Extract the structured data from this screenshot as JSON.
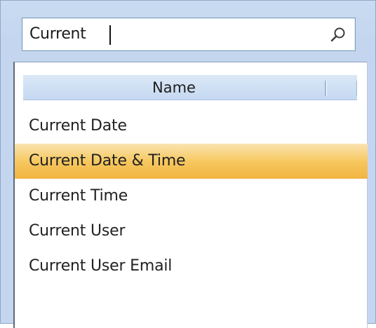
{
  "search": {
    "value": "Current",
    "icon": "search-icon"
  },
  "list": {
    "column_header": "Name",
    "items": [
      {
        "label": "Current Date",
        "selected": false
      },
      {
        "label": "Current Date & Time",
        "selected": true
      },
      {
        "label": "Current Time",
        "selected": false
      },
      {
        "label": "Current User",
        "selected": false
      },
      {
        "label": "Current User Email",
        "selected": false
      }
    ]
  },
  "colors": {
    "selection": "#f4bd4f",
    "frame": "#c4d6ef",
    "header": "#c5d9f1"
  }
}
